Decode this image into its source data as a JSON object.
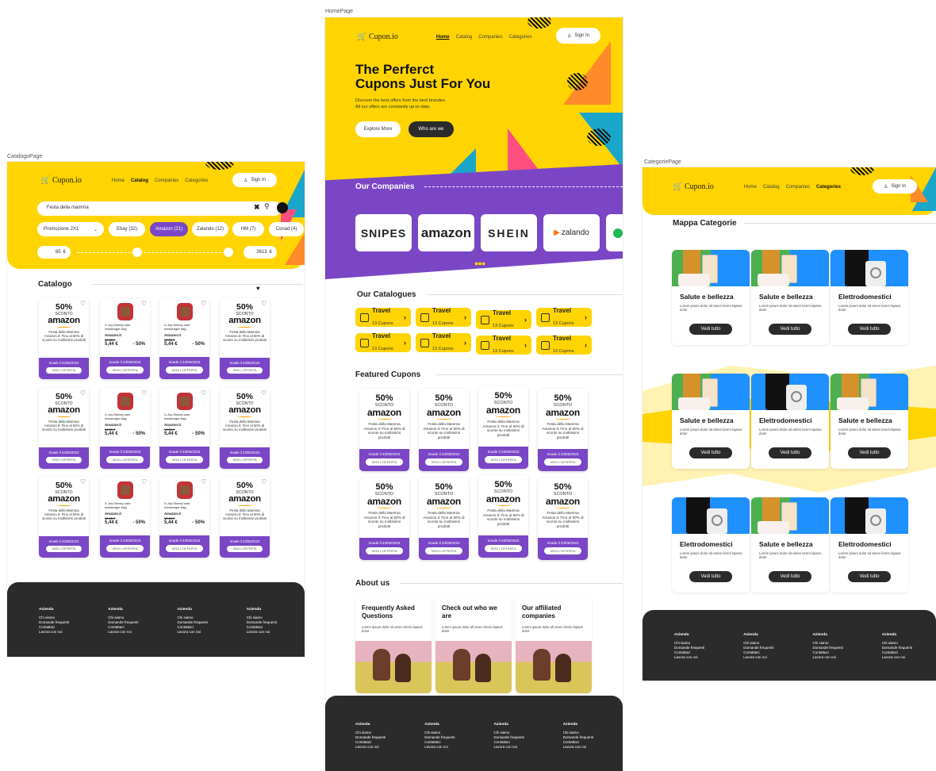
{
  "frames": {
    "catalogo": "CatalogoPage",
    "home": "HomePage",
    "categorie": "CategoriePage"
  },
  "brand": {
    "logo": "Cupon.io",
    "yellow": "#ffd400",
    "purple": "#7a46c6",
    "dark": "#2b2b2b"
  },
  "nav": {
    "home": "Home",
    "catalog": "Catalog",
    "companies": "Companies",
    "categories": "Categories",
    "signin": "Sign In"
  },
  "hero": {
    "title1": "The Perferct",
    "title2": "Cupons Just For You",
    "sub1": "Discover the best offers from the best brandes.",
    "sub2": "All our offers are constantly up-to-date,",
    "explore": "Explore More",
    "who": "Who are we"
  },
  "companies": {
    "title": "Our Companies",
    "logos": [
      "SNIPES",
      "amazon",
      "SHEIN",
      "zalando"
    ]
  },
  "catalogues": {
    "title": "Our Catalogues",
    "label": "Travel",
    "count": "13 Cupons"
  },
  "featured": {
    "title": "Featured Cupons"
  },
  "coupon": {
    "pct": "50%",
    "sconto": "SCONTO",
    "brand": "amazon",
    "desc": "Festa della Mamma Amazon.it: Fino al 50% di sconto su moltissimi prodotti",
    "scade": "Scade il 23/05/2023",
    "btn": "VEDI L'OFFERTA"
  },
  "product": {
    "name": "X-Joy Disney cars messenger bag",
    "store": "Amazon.it",
    "old": "10,88 €",
    "price": "5,44 €",
    "off": "- 50%"
  },
  "about": {
    "title": "About us",
    "cards": [
      {
        "title": "Frequently Asked Questions",
        "text": "Lorem ipsum dolor sit amen lorem lapsus dolor"
      },
      {
        "title": "Check out who we are",
        "text": "Lorem ipsum dolor all amen lorem lapsus dolor"
      },
      {
        "title": "Our affiliated companies",
        "text": "Lorem ipsum dolor all amen lorem lapsus dolor"
      }
    ]
  },
  "footer": {
    "head": "Azienda",
    "l1": "Chi siamo",
    "l2": "Domande frequenti",
    "l3": "Contattaci",
    "l4": "Lavora con noi"
  },
  "catalogo": {
    "search": "Festa della mamma",
    "filter": "Promozione 2X1",
    "stores": [
      "Ebay (32)",
      "Amazon (21)",
      "Zalando (12)",
      "HM (7)",
      "Conad (4)"
    ],
    "min": "85",
    "max": "3613",
    "currency": "€",
    "title": "Catalogo"
  },
  "categorie": {
    "title": "Mappa Categorie",
    "beauty": "Salute e bellezza",
    "elettro": "Elettrodomestici",
    "desc": "Lorem ipsum dolor sit amen lorem lapsus dolor",
    "btn": "Vedi tutto"
  }
}
